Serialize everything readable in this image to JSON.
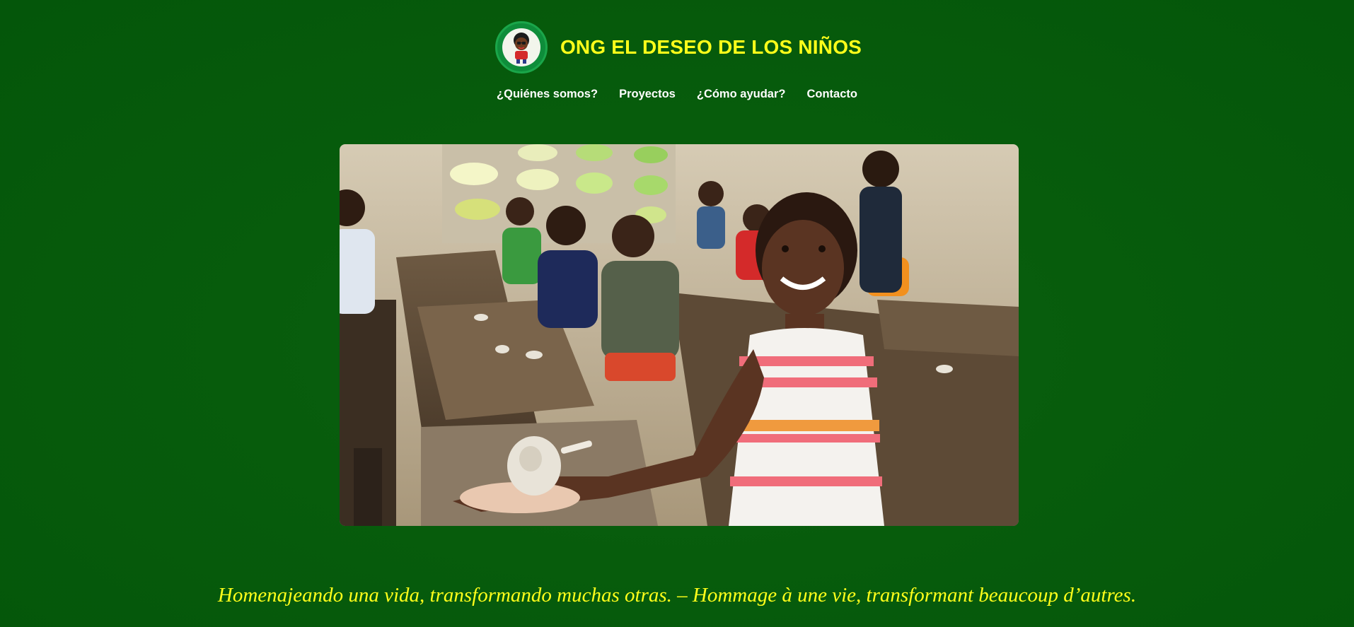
{
  "header": {
    "site_title": "ONG EL DESEO DE LOS NIÑOS",
    "logo_icon": "ngo-logo-child-avatar"
  },
  "nav": {
    "items": [
      {
        "label": "¿Quiénes somos?"
      },
      {
        "label": "Proyectos"
      },
      {
        "label": "¿Cómo ayudar?"
      },
      {
        "label": "Contacto"
      }
    ]
  },
  "hero": {
    "image_subject": "children-in-classroom-photo"
  },
  "tagline": {
    "text": "Homenajeando una vida, transformando muchas otras. – Hommage à une vie, transformant beaucoup d’autres."
  },
  "colors": {
    "background": "#075c0c",
    "title": "#ffff1a",
    "nav_text": "#ffffff",
    "tagline": "#ffff1a"
  }
}
